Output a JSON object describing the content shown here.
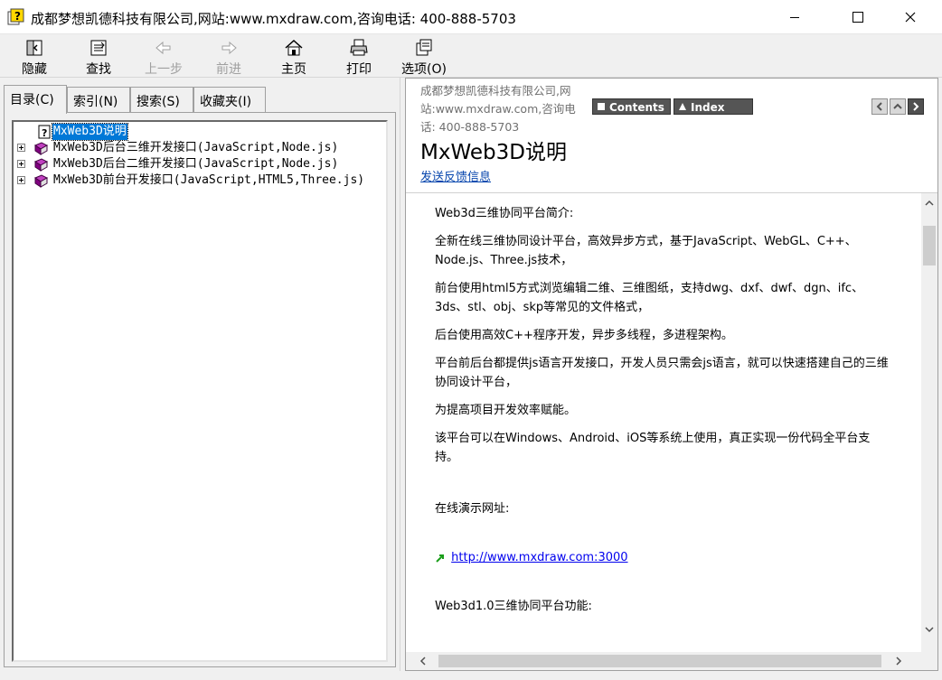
{
  "window": {
    "title": "成都梦想凯德科技有限公司,网站:www.mxdraw.com,咨询电话: 400-888-5703"
  },
  "toolbar": {
    "hide": "隐藏",
    "find": "查找",
    "back": "上一步",
    "forward": "前进",
    "home": "主页",
    "print": "打印",
    "options": "选项(O)"
  },
  "tabs": {
    "contents": "目录(C)",
    "index": "索引(N)",
    "search": "搜索(S)",
    "favorites": "收藏夹(I)"
  },
  "tree": {
    "items": [
      {
        "label": "MxWeb3D说明"
      },
      {
        "label": "MxWeb3D后台三维开发接口(JavaScript,Node.js)"
      },
      {
        "label": "MxWeb3D后台二维开发接口(JavaScript,Node.js)"
      },
      {
        "label": "MxWeb3D前台开发接口(JavaScript,HTML5,Three.js)"
      }
    ]
  },
  "topic_header": {
    "company_line1": "成都梦想凯德科技有限公司,网",
    "company_line2": "站:www.mxdraw.com,咨询电",
    "company_line3": "话: 400-888-5703",
    "contents_button": "Contents",
    "index_button": "Index",
    "title": "MxWeb3D说明",
    "feedback_link": "发送反馈信息"
  },
  "content": {
    "p1": "Web3d三维协同平台简介:",
    "p2a": "全新在线三维协同设计平台，高效异步方式，基于JavaScript、WebGL、C++、",
    "p2b": "Node.js、Three.js技术，",
    "p3a": "前台使用html5方式浏览编辑二维、三维图纸，支持dwg、dxf、dwf、dgn、ifc、",
    "p3b": "3ds、stl、obj、skp等常见的文件格式，",
    "p4": "后台使用高效C++程序开发，异步多线程，多进程架构。",
    "p5a": "平台前后台都提供js语言开发接口，开发人员只需会js语言，就可以快速搭建自己的三维",
    "p5b": "协同设计平台，",
    "p6": "为提高项目开发效率赋能。",
    "p7a": "该平台可以在Windows、Android、iOS等系统上使用，真正实现一份代码全平台支",
    "p7b": "持。",
    "p8": "在线演示网址:",
    "demo_link": "http://www.mxdraw.com:3000",
    "p9": "Web3d1.0三维协同平台功能:"
  }
}
